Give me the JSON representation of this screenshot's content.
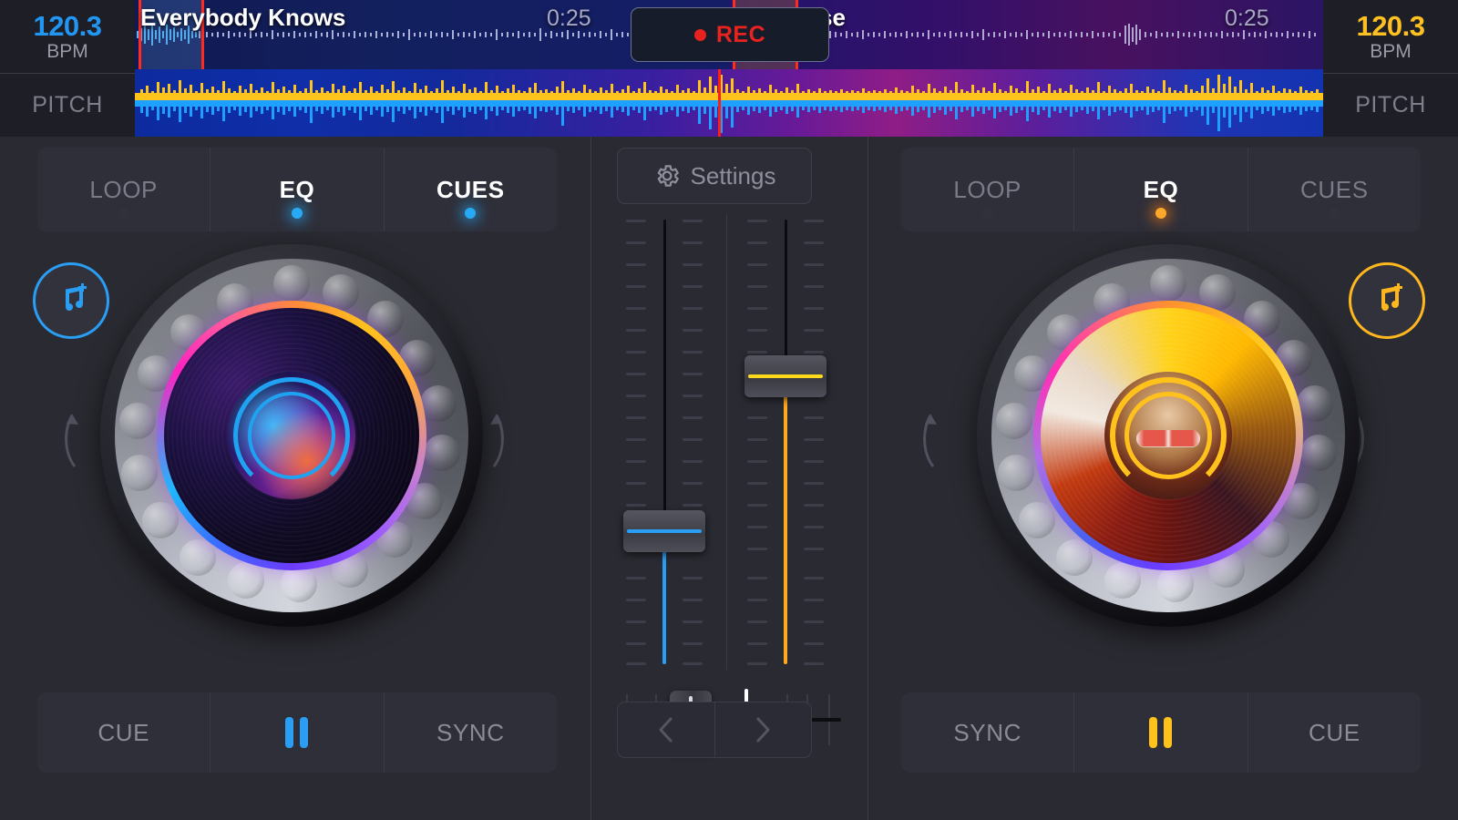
{
  "decks": {
    "a": {
      "bpm_value": "120.3",
      "bpm_label": "BPM",
      "pitch_label": "PITCH",
      "track_title": "Everybody Knows",
      "track_time": "0:25",
      "accent_color": "#2a9df4",
      "tabs": [
        {
          "label": "LOOP",
          "active": false
        },
        {
          "label": "EQ",
          "active": true
        },
        {
          "label": "CUES",
          "active": true
        }
      ],
      "add_music_icon": "music-note-plus-icon",
      "transport": [
        {
          "label": "CUE",
          "type": "text"
        },
        {
          "label": "",
          "type": "pause-icon"
        },
        {
          "label": "SYNC",
          "type": "text"
        }
      ],
      "nudge_up": "+",
      "nudge_down": "−"
    },
    "b": {
      "bpm_value": "120.3",
      "bpm_label": "BPM",
      "pitch_label": "PITCH",
      "track_title": "DJ House",
      "track_time": "0:25",
      "accent_color": "#ffc21c",
      "tabs": [
        {
          "label": "LOOP",
          "active": false
        },
        {
          "label": "EQ",
          "active": true
        },
        {
          "label": "CUES",
          "active": false
        }
      ],
      "add_music_icon": "music-note-plus-icon",
      "transport": [
        {
          "label": "SYNC",
          "type": "text"
        },
        {
          "label": "",
          "type": "pause-icon"
        },
        {
          "label": "CUE",
          "type": "text"
        }
      ],
      "nudge_up": "+",
      "nudge_down": "−"
    }
  },
  "record": {
    "label": "REC",
    "icon": "record-dot-icon",
    "color": "#e8231f",
    "active": true
  },
  "mixer": {
    "settings_label": "Settings",
    "settings_icon": "gear-icon",
    "channel_a_volume_percent": 32,
    "channel_b_volume_percent": 76,
    "crossfader_percent": 38,
    "prev_icon": "chevron-left-icon",
    "next_icon": "chevron-right-icon"
  },
  "colors": {
    "deck_a_accent": "#2a9df4",
    "deck_b_accent": "#ffc21c",
    "record_red": "#e8231f",
    "playhead_red": "#ff1e12",
    "panel_bg": "#2f2f39",
    "app_bg": "#2a2a32",
    "text_dim": "#8b8b98"
  }
}
